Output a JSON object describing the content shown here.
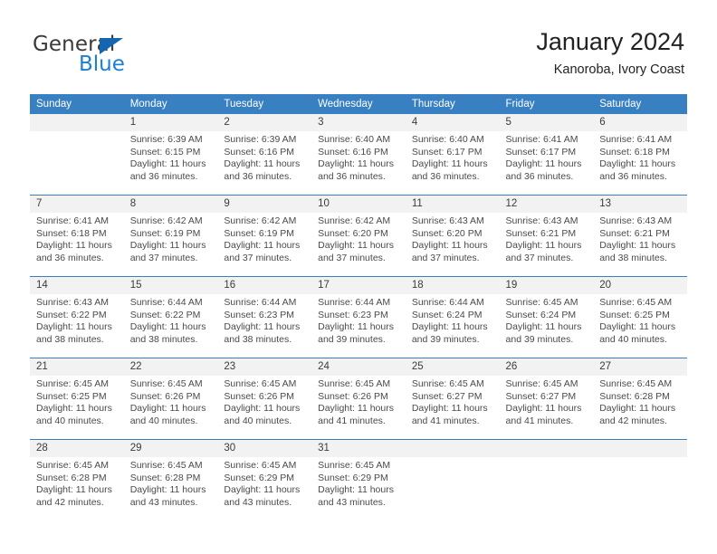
{
  "brand": {
    "name_part1": "General",
    "name_part2": "Blue",
    "accent_color": "#1b7fd4",
    "triangle_color": "#1565b0"
  },
  "header": {
    "title": "January 2024",
    "subtitle": "Kanoroba, Ivory Coast"
  },
  "theme": {
    "header_row_bg": "#3880c2",
    "daynum_bg": "#f2f2f2",
    "text_color": "#4a4a4a"
  },
  "weekdays": [
    "Sunday",
    "Monday",
    "Tuesday",
    "Wednesday",
    "Thursday",
    "Friday",
    "Saturday"
  ],
  "weeks": [
    [
      {
        "day": "",
        "sunrise": "",
        "sunset": "",
        "daylight_line1": "",
        "daylight_line2": ""
      },
      {
        "day": "1",
        "sunrise": "Sunrise: 6:39 AM",
        "sunset": "Sunset: 6:15 PM",
        "daylight_line1": "Daylight: 11 hours",
        "daylight_line2": "and 36 minutes."
      },
      {
        "day": "2",
        "sunrise": "Sunrise: 6:39 AM",
        "sunset": "Sunset: 6:16 PM",
        "daylight_line1": "Daylight: 11 hours",
        "daylight_line2": "and 36 minutes."
      },
      {
        "day": "3",
        "sunrise": "Sunrise: 6:40 AM",
        "sunset": "Sunset: 6:16 PM",
        "daylight_line1": "Daylight: 11 hours",
        "daylight_line2": "and 36 minutes."
      },
      {
        "day": "4",
        "sunrise": "Sunrise: 6:40 AM",
        "sunset": "Sunset: 6:17 PM",
        "daylight_line1": "Daylight: 11 hours",
        "daylight_line2": "and 36 minutes."
      },
      {
        "day": "5",
        "sunrise": "Sunrise: 6:41 AM",
        "sunset": "Sunset: 6:17 PM",
        "daylight_line1": "Daylight: 11 hours",
        "daylight_line2": "and 36 minutes."
      },
      {
        "day": "6",
        "sunrise": "Sunrise: 6:41 AM",
        "sunset": "Sunset: 6:18 PM",
        "daylight_line1": "Daylight: 11 hours",
        "daylight_line2": "and 36 minutes."
      }
    ],
    [
      {
        "day": "7",
        "sunrise": "Sunrise: 6:41 AM",
        "sunset": "Sunset: 6:18 PM",
        "daylight_line1": "Daylight: 11 hours",
        "daylight_line2": "and 36 minutes."
      },
      {
        "day": "8",
        "sunrise": "Sunrise: 6:42 AM",
        "sunset": "Sunset: 6:19 PM",
        "daylight_line1": "Daylight: 11 hours",
        "daylight_line2": "and 37 minutes."
      },
      {
        "day": "9",
        "sunrise": "Sunrise: 6:42 AM",
        "sunset": "Sunset: 6:19 PM",
        "daylight_line1": "Daylight: 11 hours",
        "daylight_line2": "and 37 minutes."
      },
      {
        "day": "10",
        "sunrise": "Sunrise: 6:42 AM",
        "sunset": "Sunset: 6:20 PM",
        "daylight_line1": "Daylight: 11 hours",
        "daylight_line2": "and 37 minutes."
      },
      {
        "day": "11",
        "sunrise": "Sunrise: 6:43 AM",
        "sunset": "Sunset: 6:20 PM",
        "daylight_line1": "Daylight: 11 hours",
        "daylight_line2": "and 37 minutes."
      },
      {
        "day": "12",
        "sunrise": "Sunrise: 6:43 AM",
        "sunset": "Sunset: 6:21 PM",
        "daylight_line1": "Daylight: 11 hours",
        "daylight_line2": "and 37 minutes."
      },
      {
        "day": "13",
        "sunrise": "Sunrise: 6:43 AM",
        "sunset": "Sunset: 6:21 PM",
        "daylight_line1": "Daylight: 11 hours",
        "daylight_line2": "and 38 minutes."
      }
    ],
    [
      {
        "day": "14",
        "sunrise": "Sunrise: 6:43 AM",
        "sunset": "Sunset: 6:22 PM",
        "daylight_line1": "Daylight: 11 hours",
        "daylight_line2": "and 38 minutes."
      },
      {
        "day": "15",
        "sunrise": "Sunrise: 6:44 AM",
        "sunset": "Sunset: 6:22 PM",
        "daylight_line1": "Daylight: 11 hours",
        "daylight_line2": "and 38 minutes."
      },
      {
        "day": "16",
        "sunrise": "Sunrise: 6:44 AM",
        "sunset": "Sunset: 6:23 PM",
        "daylight_line1": "Daylight: 11 hours",
        "daylight_line2": "and 38 minutes."
      },
      {
        "day": "17",
        "sunrise": "Sunrise: 6:44 AM",
        "sunset": "Sunset: 6:23 PM",
        "daylight_line1": "Daylight: 11 hours",
        "daylight_line2": "and 39 minutes."
      },
      {
        "day": "18",
        "sunrise": "Sunrise: 6:44 AM",
        "sunset": "Sunset: 6:24 PM",
        "daylight_line1": "Daylight: 11 hours",
        "daylight_line2": "and 39 minutes."
      },
      {
        "day": "19",
        "sunrise": "Sunrise: 6:45 AM",
        "sunset": "Sunset: 6:24 PM",
        "daylight_line1": "Daylight: 11 hours",
        "daylight_line2": "and 39 minutes."
      },
      {
        "day": "20",
        "sunrise": "Sunrise: 6:45 AM",
        "sunset": "Sunset: 6:25 PM",
        "daylight_line1": "Daylight: 11 hours",
        "daylight_line2": "and 40 minutes."
      }
    ],
    [
      {
        "day": "21",
        "sunrise": "Sunrise: 6:45 AM",
        "sunset": "Sunset: 6:25 PM",
        "daylight_line1": "Daylight: 11 hours",
        "daylight_line2": "and 40 minutes."
      },
      {
        "day": "22",
        "sunrise": "Sunrise: 6:45 AM",
        "sunset": "Sunset: 6:26 PM",
        "daylight_line1": "Daylight: 11 hours",
        "daylight_line2": "and 40 minutes."
      },
      {
        "day": "23",
        "sunrise": "Sunrise: 6:45 AM",
        "sunset": "Sunset: 6:26 PM",
        "daylight_line1": "Daylight: 11 hours",
        "daylight_line2": "and 40 minutes."
      },
      {
        "day": "24",
        "sunrise": "Sunrise: 6:45 AM",
        "sunset": "Sunset: 6:26 PM",
        "daylight_line1": "Daylight: 11 hours",
        "daylight_line2": "and 41 minutes."
      },
      {
        "day": "25",
        "sunrise": "Sunrise: 6:45 AM",
        "sunset": "Sunset: 6:27 PM",
        "daylight_line1": "Daylight: 11 hours",
        "daylight_line2": "and 41 minutes."
      },
      {
        "day": "26",
        "sunrise": "Sunrise: 6:45 AM",
        "sunset": "Sunset: 6:27 PM",
        "daylight_line1": "Daylight: 11 hours",
        "daylight_line2": "and 41 minutes."
      },
      {
        "day": "27",
        "sunrise": "Sunrise: 6:45 AM",
        "sunset": "Sunset: 6:28 PM",
        "daylight_line1": "Daylight: 11 hours",
        "daylight_line2": "and 42 minutes."
      }
    ],
    [
      {
        "day": "28",
        "sunrise": "Sunrise: 6:45 AM",
        "sunset": "Sunset: 6:28 PM",
        "daylight_line1": "Daylight: 11 hours",
        "daylight_line2": "and 42 minutes."
      },
      {
        "day": "29",
        "sunrise": "Sunrise: 6:45 AM",
        "sunset": "Sunset: 6:28 PM",
        "daylight_line1": "Daylight: 11 hours",
        "daylight_line2": "and 43 minutes."
      },
      {
        "day": "30",
        "sunrise": "Sunrise: 6:45 AM",
        "sunset": "Sunset: 6:29 PM",
        "daylight_line1": "Daylight: 11 hours",
        "daylight_line2": "and 43 minutes."
      },
      {
        "day": "31",
        "sunrise": "Sunrise: 6:45 AM",
        "sunset": "Sunset: 6:29 PM",
        "daylight_line1": "Daylight: 11 hours",
        "daylight_line2": "and 43 minutes."
      },
      {
        "day": "",
        "sunrise": "",
        "sunset": "",
        "daylight_line1": "",
        "daylight_line2": ""
      },
      {
        "day": "",
        "sunrise": "",
        "sunset": "",
        "daylight_line1": "",
        "daylight_line2": ""
      },
      {
        "day": "",
        "sunrise": "",
        "sunset": "",
        "daylight_line1": "",
        "daylight_line2": ""
      }
    ]
  ]
}
